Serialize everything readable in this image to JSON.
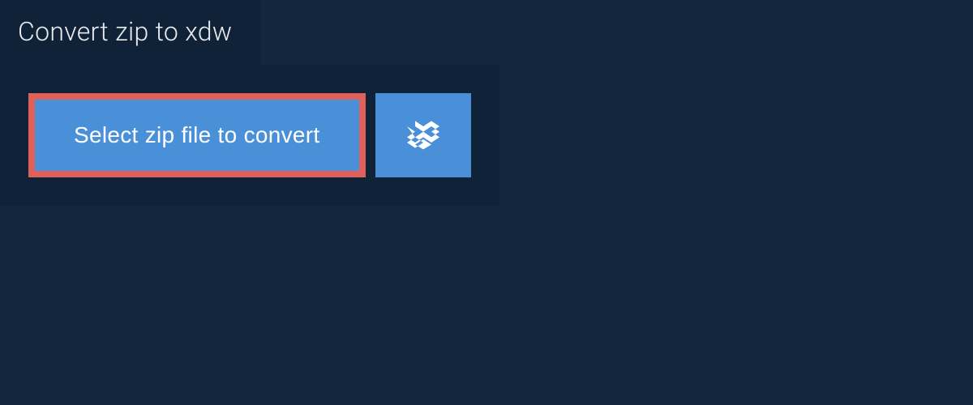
{
  "header": {
    "title": "Convert zip to xdw"
  },
  "actions": {
    "select_file_label": "Select zip file to convert"
  }
}
